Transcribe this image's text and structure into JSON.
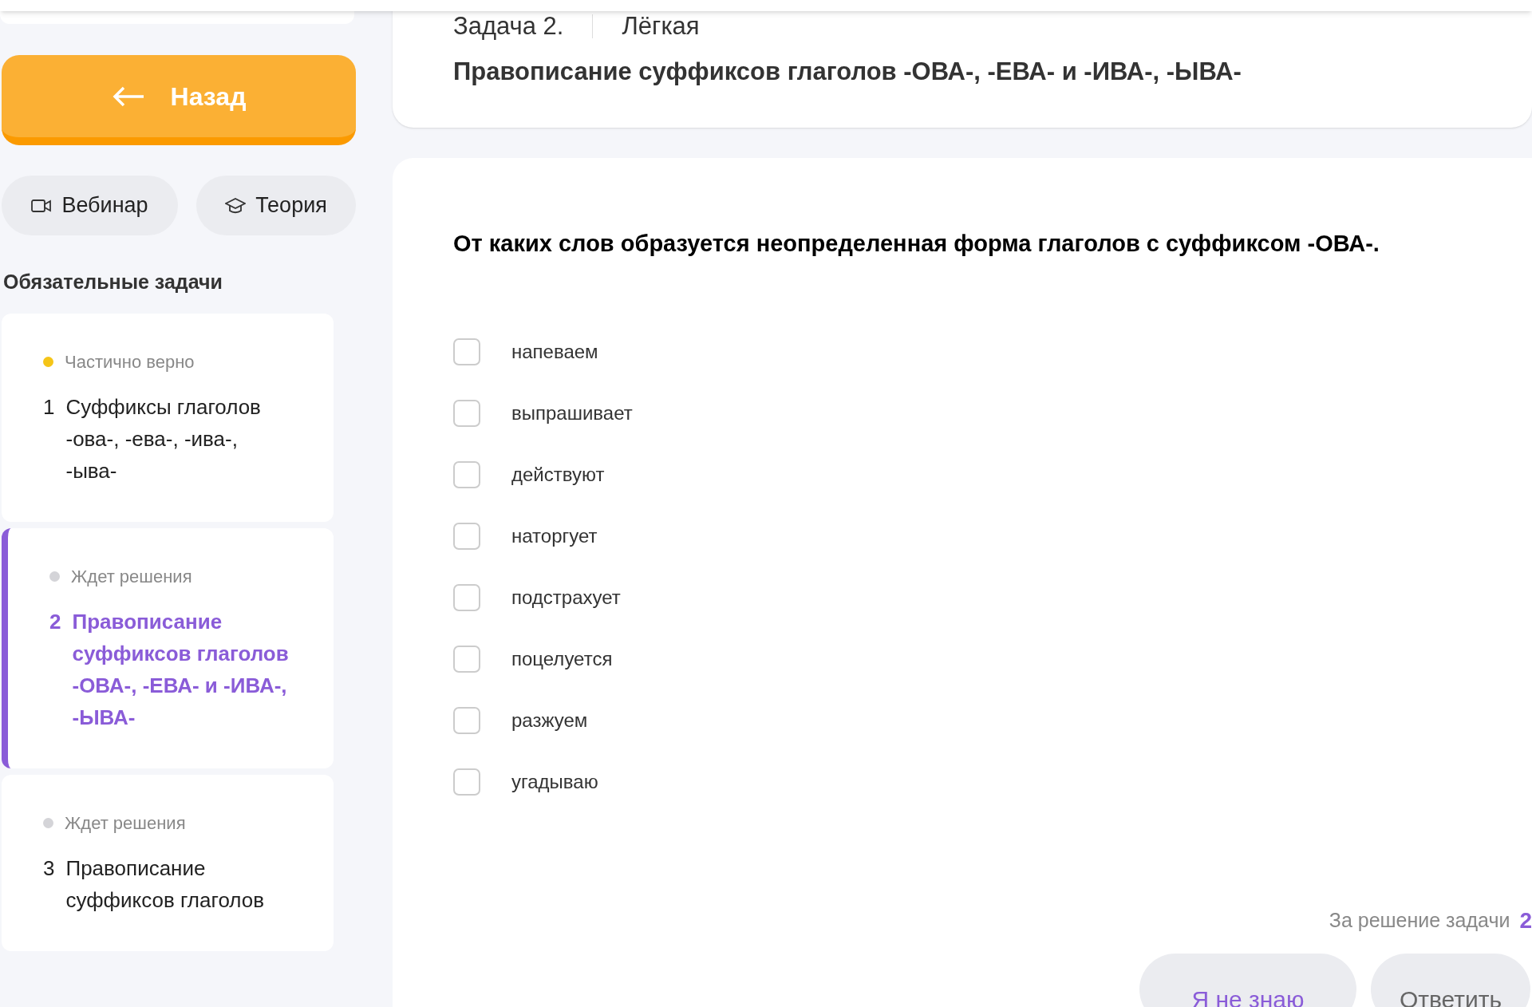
{
  "sidebar": {
    "back_button": {
      "label": "Назад"
    },
    "links": [
      {
        "kind": "video",
        "label": "Вебинар"
      },
      {
        "kind": "theory",
        "label": "Теория"
      }
    ],
    "section_title": "Обязательные задачи",
    "tasks": [
      {
        "status": "Частично верно",
        "color": "#f5c518",
        "number": "1",
        "title": "Суффиксы глаголов -ова-, -ева-, -ива-, -ыва-",
        "selected": false
      },
      {
        "status": "Ждет решения",
        "color": "#d4d4d8",
        "number": "2",
        "title": "Правописание суффиксов глаголов -ОВА-, -ЕВА- и -ИВА-, -ЫВА-",
        "selected": true
      },
      {
        "status": "Ждет решения",
        "color": "#d4d4d8",
        "number": "3",
        "title": "Правописание суффиксов глаголов",
        "selected": false
      }
    ]
  },
  "header": {
    "task_label": "Задача 2.",
    "difficulty": "Лёгкая",
    "title": "Правописание суффиксов глаголов -ОВА-, -ЕВА- и -ИВА-, -ЫВА-"
  },
  "question": {
    "text": "От каких слов образуется неопределенная форма глаголов с суффиксом -ОВА-.",
    "options": [
      {
        "label": "напеваем",
        "checked": false
      },
      {
        "label": "выпрашивает",
        "checked": false
      },
      {
        "label": "действуют",
        "checked": false
      },
      {
        "label": "наторгует",
        "checked": false
      },
      {
        "label": "подстрахует",
        "checked": false
      },
      {
        "label": "поцелуется",
        "checked": false
      },
      {
        "label": "разжуем",
        "checked": false
      },
      {
        "label": "угадываю",
        "checked": false
      }
    ],
    "reward_label": "За решение задачи",
    "reward_value": "2",
    "buttons": [
      {
        "kind": "secondary",
        "label": "Я не знаю"
      },
      {
        "kind": "primary",
        "label": "Ответить"
      }
    ]
  }
}
